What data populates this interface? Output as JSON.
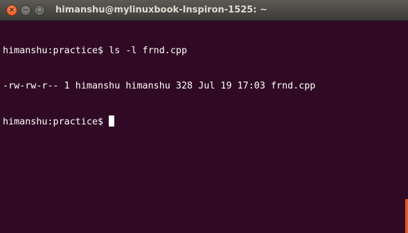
{
  "window": {
    "title": "himanshu@mylinuxbook-Inspiron-1525: ~",
    "buttons": {
      "close": "×",
      "minimize": "−",
      "maximize": "□"
    }
  },
  "terminal": {
    "lines": [
      "himanshu:practice$ ls -l frnd.cpp",
      "-rw-rw-r-- 1 himanshu himanshu 328 Jul 19 17:03 frnd.cpp"
    ],
    "prompt": "himanshu:practice$ "
  },
  "colors": {
    "background": "#300a24",
    "titlebar": "#3c3b37",
    "close_button": "#df4b16",
    "scrollbar_thumb": "#e05c2a"
  }
}
